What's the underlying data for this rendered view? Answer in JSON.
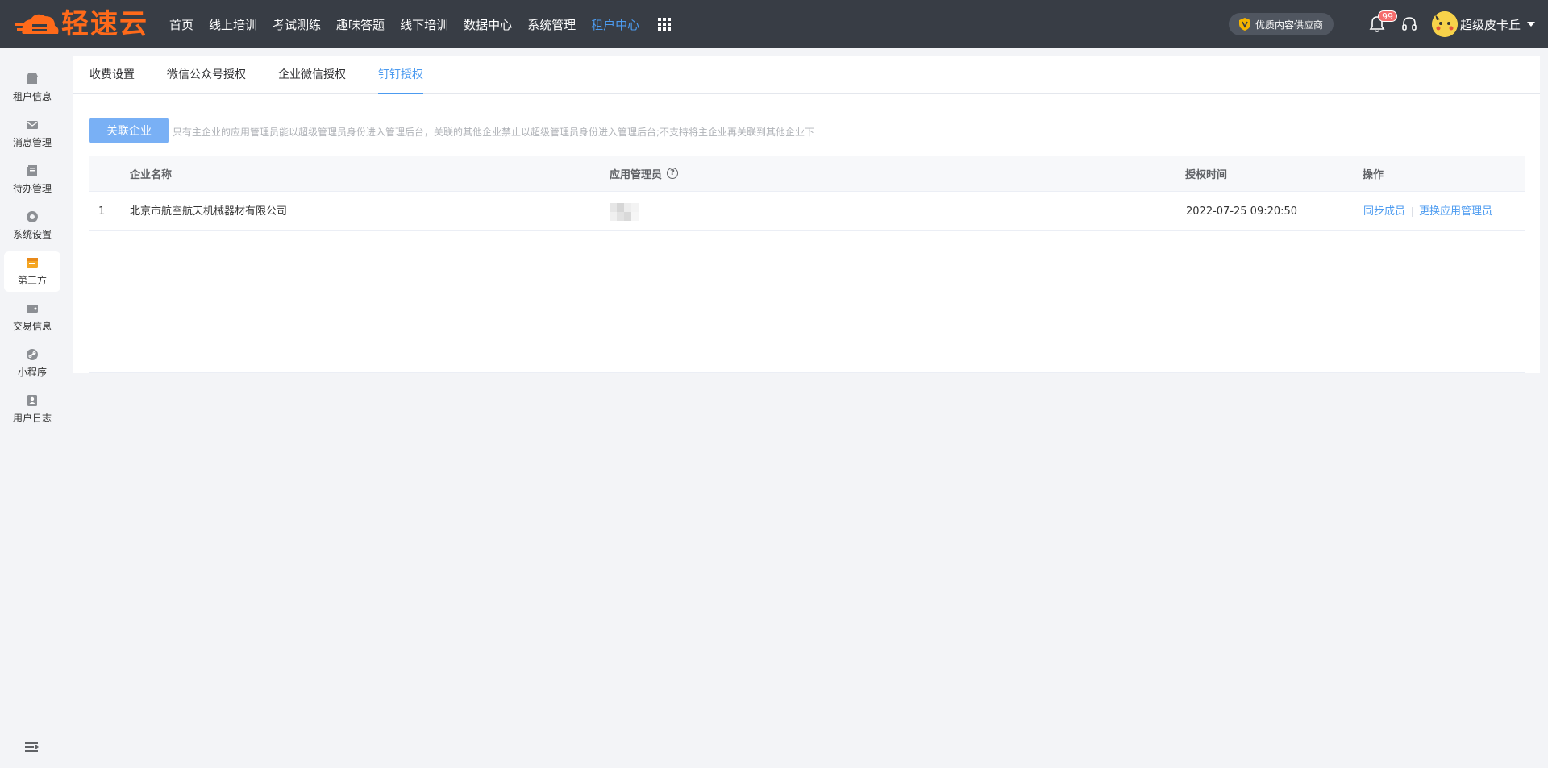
{
  "app": {
    "logo_text": "轻速云"
  },
  "nav": {
    "items": [
      {
        "label": "首页",
        "active": false
      },
      {
        "label": "线上培训",
        "active": false
      },
      {
        "label": "考试测练",
        "active": false
      },
      {
        "label": "趣味答题",
        "active": false
      },
      {
        "label": "线下培训",
        "active": false
      },
      {
        "label": "数据中心",
        "active": false
      },
      {
        "label": "系统管理",
        "active": false
      },
      {
        "label": "租户中心",
        "active": true
      }
    ]
  },
  "header": {
    "provider_badge": "优质内容供应商",
    "notification_count": "99",
    "user_name": "超级皮卡丘"
  },
  "sidebar": {
    "items": [
      {
        "label": "租户信息",
        "icon": "store-icon"
      },
      {
        "label": "消息管理",
        "icon": "mail-icon"
      },
      {
        "label": "待办管理",
        "icon": "todo-icon"
      },
      {
        "label": "系统设置",
        "icon": "settings-icon"
      },
      {
        "label": "第三方",
        "icon": "third-party-icon",
        "active": true
      },
      {
        "label": "交易信息",
        "icon": "wallet-icon"
      },
      {
        "label": "小程序",
        "icon": "link-icon"
      },
      {
        "label": "用户日志",
        "icon": "contact-icon"
      }
    ]
  },
  "tabs": [
    {
      "label": "收费设置",
      "active": false
    },
    {
      "label": "微信公众号授权",
      "active": false
    },
    {
      "label": "企业微信授权",
      "active": false
    },
    {
      "label": "钉钉授权",
      "active": true
    }
  ],
  "toolbar": {
    "link_button": "关联企业",
    "hint": "只有主企业的应用管理员能以超级管理员身份进入管理后台，关联的其他企业禁止以超级管理员身份进入管理后台;不支持将主企业再关联到其他企业下"
  },
  "table": {
    "columns": [
      "企业名称",
      "应用管理员",
      "授权时间",
      "操作"
    ],
    "help_symbol": "?",
    "rows": [
      {
        "index": "1",
        "company": "北京市航空航天机械器材有限公司",
        "admin": "",
        "auth_time": "2022-07-25 09:20:50",
        "actions": [
          "同步成员",
          "更换应用管理员"
        ]
      }
    ]
  },
  "colors": {
    "topbar": "#383d45",
    "accent": "#4c9bf0",
    "logo": "#ff6a1a",
    "button": "#79b0f5"
  }
}
